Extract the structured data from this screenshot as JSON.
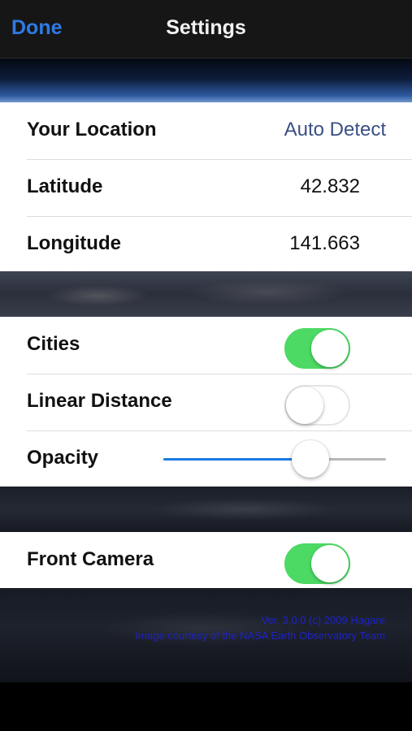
{
  "nav": {
    "done_label": "Done",
    "title": "Settings"
  },
  "location": {
    "your_location_label": "Your Location",
    "your_location_value": "Auto Detect",
    "latitude_label": "Latitude",
    "latitude_value": "42.832",
    "longitude_label": "Longitude",
    "longitude_value": "141.663"
  },
  "display": {
    "cities_label": "Cities",
    "cities_on": true,
    "linear_distance_label": "Linear Distance",
    "linear_distance_on": false,
    "opacity_label": "Opacity",
    "opacity_value": 0.66
  },
  "camera": {
    "front_camera_label": "Front Camera",
    "front_camera_on": true
  },
  "credits": {
    "version_line": "Ver. 3.0.0 (c) 2009 Hagare",
    "image_line": "Image courtesy of the NASA Earth Observatory Team"
  },
  "colors": {
    "accent_blue": "#2f7ae5",
    "toggle_green": "#4cd964",
    "credit_text": "#1d22c8"
  }
}
